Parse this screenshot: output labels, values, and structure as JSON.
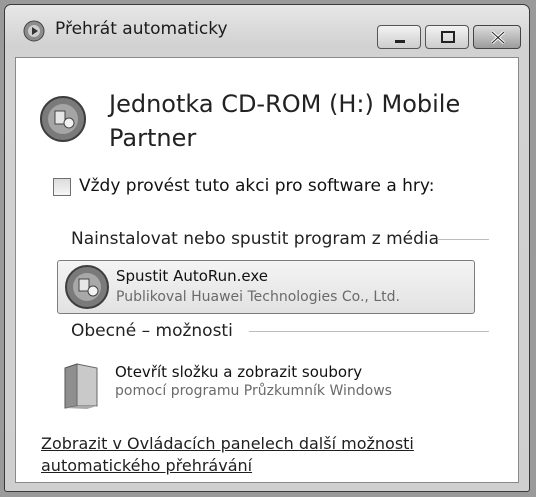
{
  "window": {
    "title": "Přehrát automaticky",
    "title_icon": "autoplay-icon",
    "controls": [
      "minimize-icon",
      "maximize-icon",
      "close-icon"
    ]
  },
  "device": {
    "icon": "cd-drive-icon",
    "title": "Jednotka CD-ROM (H:) Mobile Partner"
  },
  "always": {
    "checked": false,
    "label": "Vždy provést tuto akci pro software a hry:"
  },
  "install_section": {
    "header": "Nainstalovat nebo spustit program z média",
    "option": {
      "icon": "autorun-disc-icon",
      "title": "Spustit AutoRun.exe",
      "subtitle": "Publikoval Huawei Technologies Co., Ltd."
    }
  },
  "general_section": {
    "header": "Obecné – možnosti",
    "option": {
      "icon": "folder-icon",
      "title": "Otevřít složku a zobrazit soubory",
      "subtitle": "pomocí programu Průzkumník Windows"
    }
  },
  "more_link": "Zobrazit v Ovládacích panelech další možnosti automatického přehrávání"
}
